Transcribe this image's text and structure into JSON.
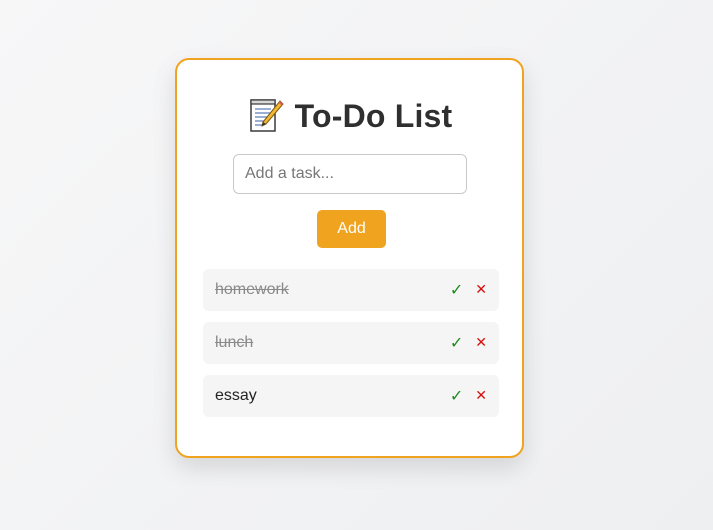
{
  "app": {
    "title": "To-Do List",
    "title_icon": "memo-pencil-icon"
  },
  "input": {
    "placeholder": "Add a task...",
    "value": ""
  },
  "add_button": {
    "label": "Add"
  },
  "tasks": [
    {
      "text": "homework",
      "completed": true,
      "complete_label": "✓",
      "delete_label": "✕"
    },
    {
      "text": "lunch",
      "completed": true,
      "complete_label": "✓",
      "delete_label": "✕"
    },
    {
      "text": "essay",
      "completed": false,
      "complete_label": "✓",
      "delete_label": "✕"
    }
  ],
  "colors": {
    "accent": "#f0a31f",
    "check": "#1e8a1e",
    "delete": "#d40f0f"
  }
}
